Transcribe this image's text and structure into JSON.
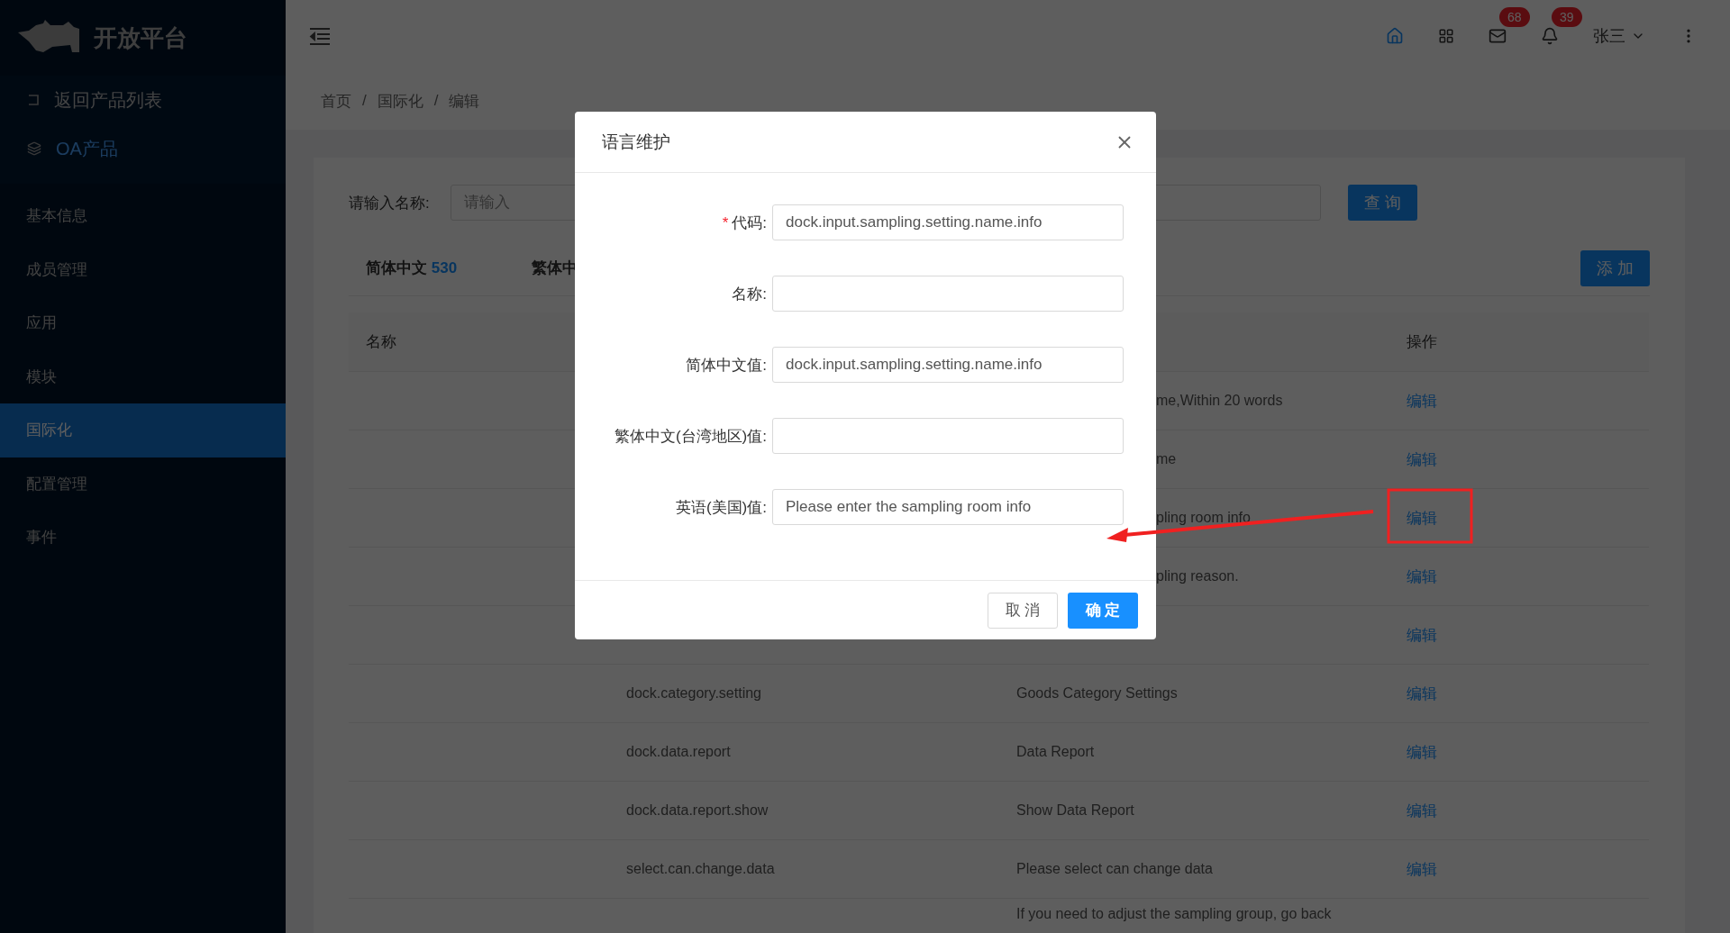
{
  "sidebar": {
    "brand": "开放平台",
    "back_link": "返回产品列表",
    "product": "OA产品",
    "items": [
      {
        "label": "基本信息",
        "selected": false
      },
      {
        "label": "成员管理",
        "selected": false
      },
      {
        "label": "应用",
        "selected": false
      },
      {
        "label": "模块",
        "selected": false
      },
      {
        "label": "国际化",
        "selected": true
      },
      {
        "label": "配置管理",
        "selected": false
      },
      {
        "label": "事件",
        "selected": false
      }
    ]
  },
  "header": {
    "notifications": [
      {
        "kind": "mail",
        "count": "68"
      },
      {
        "kind": "bell",
        "count": "39"
      }
    ],
    "user": "张三"
  },
  "breadcrumb": {
    "items": [
      "首页",
      "国际化",
      "编辑"
    ],
    "separator": "/"
  },
  "filter": {
    "label": "请输入名称:",
    "placeholder": "请输入",
    "button": "查 询"
  },
  "tabs": [
    {
      "label": "简体中文",
      "count": "530"
    },
    {
      "label": "繁体中"
    }
  ],
  "add_button": "添 加",
  "table": {
    "columns": [
      "名称",
      "操作"
    ],
    "rows": [
      {
        "value": "me,Within 20 words",
        "kind": "cut",
        "action": "编辑"
      },
      {
        "value": "me",
        "kind": "cut",
        "action": "编辑"
      },
      {
        "value": "pling room info",
        "kind": "cut",
        "action": "编辑"
      },
      {
        "value": "pling reason.",
        "kind": "cut",
        "action": "编辑"
      },
      {
        "kind": "hidden",
        "action": "编辑"
      },
      {
        "name": "dock.category.setting",
        "value": "Goods Category Settings",
        "kind": "full",
        "action": "编辑"
      },
      {
        "name": "dock.data.report",
        "value": "Data Report",
        "kind": "full",
        "action": "编辑"
      },
      {
        "name": "dock.data.report.show",
        "value": "Show Data Report",
        "kind": "full",
        "action": "编辑"
      },
      {
        "name": "select.can.change.data",
        "value": "Please select can change data",
        "kind": "full",
        "action": "编辑"
      },
      {
        "value": "If you need to adjust the sampling group, go back",
        "kind": "full"
      }
    ]
  },
  "modal": {
    "title": "语言维护",
    "fields": [
      {
        "label": "代码:",
        "required": true,
        "value": "dock.input.sampling.setting.name.info"
      },
      {
        "label": "名称:",
        "required": false
      },
      {
        "label": "简体中文值:",
        "required": false,
        "value": "dock.input.sampling.setting.name.info"
      },
      {
        "label": "繁体中文(台湾地区)值:",
        "required": false
      },
      {
        "label": "英语(美国)值:",
        "required": false,
        "value": "Please enter the sampling room info"
      }
    ],
    "required_mark": "*",
    "cancel": "取 消",
    "ok": "确 定"
  }
}
